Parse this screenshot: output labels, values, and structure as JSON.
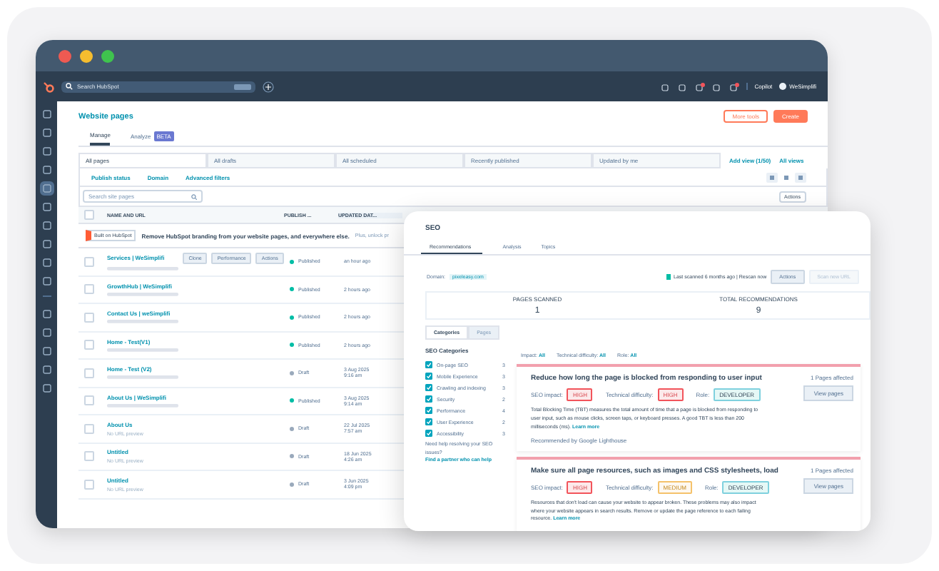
{
  "top_bar": {
    "search": {
      "placeholder": "Search HubSpot"
    },
    "copilot": "Copilot",
    "account": "WeSimplifi"
  },
  "page": {
    "title": "Website pages",
    "more_tools": "More tools",
    "create": "Create",
    "tabs": [
      {
        "label": "Manage",
        "selected": true
      },
      {
        "label": "Analyze",
        "selected": false,
        "badge": "BETA"
      }
    ],
    "views": [
      {
        "label": "All pages",
        "selected": true
      },
      {
        "label": "All drafts",
        "selected": false
      },
      {
        "label": "All scheduled",
        "selected": false
      },
      {
        "label": "Recently published",
        "selected": false
      },
      {
        "label": "Updated by me",
        "selected": false
      }
    ],
    "add_view": "Add view (1/50)",
    "all_views": "All views",
    "filters": [
      "Publish status",
      "Domain"
    ],
    "advanced_filters": "Advanced filters",
    "search": {
      "placeholder": "Search site pages"
    },
    "actions": "Actions",
    "select_all": {
      "checked": false
    },
    "columns": [
      "NAME AND URL",
      "PUBLISH ...",
      "UPDATED DAT..."
    ],
    "banner": {
      "badge": "Built on HubSpot",
      "text": "Remove HubSpot branding from your website pages, and everywhere else.",
      "more": "Plus, unlock pr"
    },
    "rows": [
      {
        "name": "Services | WeSimplifi",
        "checked": false,
        "status": "Published",
        "color": "#00bda5",
        "updated": "an hour ago",
        "buttons": [
          "Clone",
          "Performance",
          "Actions"
        ]
      },
      {
        "name": "GrowthHub | WeSimplifi",
        "checked": false,
        "status": "Published",
        "color": "#00bda5",
        "updated": "2 hours ago"
      },
      {
        "name": "Contact Us | weSimplifi",
        "checked": false,
        "status": "Published",
        "color": "#00bda5",
        "updated": "2 hours ago"
      },
      {
        "name": "Home - Test(V1)",
        "checked": false,
        "status": "Published",
        "color": "#00bda5",
        "updated": "2 hours ago"
      },
      {
        "name": "Home - Test (V2)",
        "checked": false,
        "status": "Draft",
        "color": "#99a9bb",
        "updated": "3 Aug 2025",
        "time": "9:16 am"
      },
      {
        "name": "About Us | WeSimplifi",
        "checked": false,
        "status": "Published",
        "color": "#00bda5",
        "updated": "3 Aug 2025",
        "time": "9:14 am"
      },
      {
        "name": "About Us",
        "checked": false,
        "subtitle": "No URL preview",
        "status": "Draft",
        "color": "#99a9bb",
        "updated": "22 Jul 2025",
        "time": "7:57 am"
      },
      {
        "name": "Untitled",
        "checked": false,
        "subtitle": "No URL preview",
        "status": "Draft",
        "color": "#99a9bb",
        "updated": "18 Jun 2025",
        "time": "4:26 am"
      },
      {
        "name": "Untitled",
        "checked": false,
        "subtitle": "No URL preview",
        "status": "Draft",
        "color": "#99a9bb",
        "updated": "3 Jun 2025",
        "time": "4:09 pm"
      }
    ]
  },
  "seo": {
    "title": "SEO",
    "tabs": [
      {
        "label": "Recommendations",
        "selected": true
      },
      {
        "label": "Analysis",
        "selected": false
      },
      {
        "label": "Topics",
        "selected": false
      }
    ],
    "domain_label": "Domain:",
    "domain": "pixeleasy.com",
    "scan_status": "Last scanned 6 months ago | Rescan now",
    "actions": "Actions",
    "scan_new": "Scan new URL",
    "stats": [
      {
        "label": "PAGES SCANNED",
        "value": "1"
      },
      {
        "label": "TOTAL RECOMMENDATIONS",
        "value": "9"
      }
    ],
    "toggle": [
      {
        "label": "Categories",
        "selected": true
      },
      {
        "label": "Pages",
        "selected": false
      }
    ],
    "categories_title": "SEO Categories",
    "categories": [
      {
        "label": "On-page SEO",
        "count": "3",
        "checked": true
      },
      {
        "label": "Mobile Experience",
        "count": "3",
        "checked": true
      },
      {
        "label": "Crawling and indexing",
        "count": "3",
        "checked": true
      },
      {
        "label": "Security",
        "count": "2",
        "checked": true
      },
      {
        "label": "Performance",
        "count": "4",
        "checked": true
      },
      {
        "label": "User Experience",
        "count": "2",
        "checked": true
      },
      {
        "label": "Accessibility",
        "count": "3",
        "checked": true
      }
    ],
    "help": "Need help resolving your SEO issues? ",
    "help_link": "Find a partner who can help",
    "filters": [
      {
        "label": "Impact:",
        "value": "All"
      },
      {
        "label": "Technical difficulty:",
        "value": "All"
      },
      {
        "label": "Role:",
        "value": "All"
      }
    ],
    "recommendations": [
      {
        "title": "Reduce how long the page is blocked from responding to user input",
        "tags": [
          {
            "label": "SEO impact:",
            "value": "HIGH",
            "kind": "high"
          },
          {
            "label": "Technical difficulty:",
            "value": "HIGH",
            "kind": "high"
          },
          {
            "label": "Role:",
            "value": "DEVELOPER",
            "kind": "role"
          }
        ],
        "affected": "1 Pages affected",
        "button": "View pages",
        "description": "Total Blocking Time (TBT) measures the total amount of time that a page is blocked from responding to user input, such as mouse clicks, screen taps, or keyboard presses. A good TBT is less than 200 milliseconds (ms).",
        "link": "Learn more",
        "source": "Recommended by Google Lighthouse"
      },
      {
        "title": "Make sure all page resources, such as images and CSS stylesheets, load",
        "tags": [
          {
            "label": "SEO impact:",
            "value": "HIGH",
            "kind": "high"
          },
          {
            "label": "Technical difficulty:",
            "value": "MEDIUM",
            "kind": "medium"
          },
          {
            "label": "Role:",
            "value": "DEVELOPER",
            "kind": "role"
          }
        ],
        "affected": "1 Pages affected",
        "button": "View pages",
        "description": "Resources that don't load can cause your website to appear broken. These problems may also impact where your website appears in search results. Remove or update the page reference to each failing resource.",
        "link": "Learn more"
      }
    ]
  }
}
